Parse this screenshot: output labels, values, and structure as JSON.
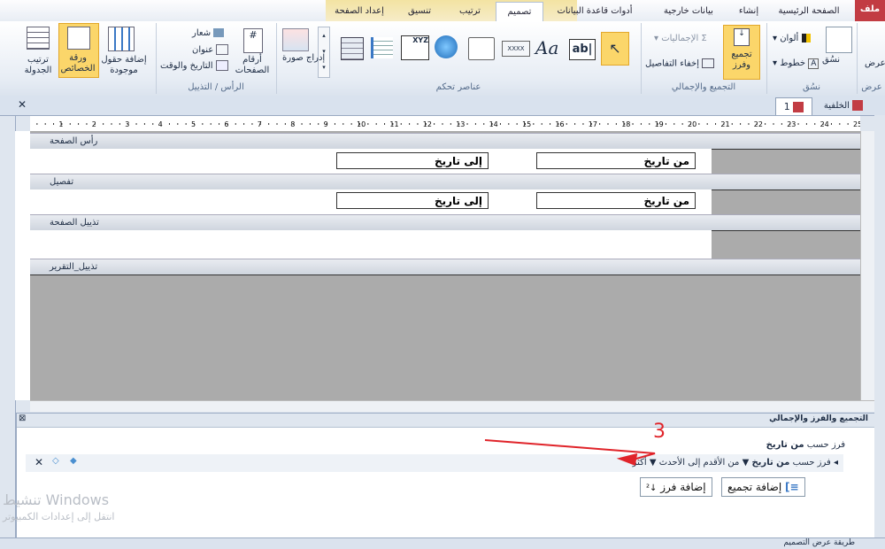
{
  "ribbon_tabs": [
    "الصفحة الرئيسية",
    "إنشاء",
    "بيانات خارجية",
    "أدوات قاعدة البيانات",
    "تصميم",
    "ترتيب",
    "تنسيق",
    "إعداد الصفحة"
  ],
  "file_tab": "ملف",
  "groups": {
    "views": {
      "label": "عرض",
      "btn": "عرض"
    },
    "themes": {
      "label": "نسُق",
      "theme_btn": "نسُق",
      "colors": "ألوان",
      "fonts": "خطوط"
    },
    "grouping": {
      "label": "التجميع والإجمالي",
      "group_sort": "تجميع وفرز",
      "totals": "الإجماليات",
      "hide_details": "إخفاء التفاصيل"
    },
    "controls": {
      "label": "عناصر تحكم",
      "label_btn": "ab|",
      "textbox_btn": "Aa",
      "xxxx": "XXXX",
      "xyz": "XYZ",
      "insert_image": "إدراج صورة"
    },
    "header_footer": {
      "label": "الرأس / التذييل",
      "page_numbers": "أرقام الصفحات",
      "logo": "شعار",
      "title": "عنوان",
      "date_time": "التاريخ والوقت"
    },
    "tools": {
      "add_fields": "إضافة حقول موجودة",
      "property_sheet": "ورقة الخصائص",
      "tab_order": "ترتيب الجدولة"
    }
  },
  "doc_tabs": [
    {
      "label": "1",
      "active": true
    },
    {
      "label": "الخلفية",
      "active": false
    }
  ],
  "ruler_numbers": [
    "1",
    "2",
    "3",
    "4",
    "5",
    "6",
    "7",
    "8",
    "9",
    "10",
    "11",
    "12",
    "13",
    "14",
    "15",
    "16",
    "17",
    "18",
    "19",
    "20",
    "21",
    "22",
    "23",
    "24",
    "25"
  ],
  "sections": {
    "page_header": "رأس الصفحة",
    "detail": "تفصيل",
    "page_footer": "تذييل الصفحة",
    "report_footer": "تذييل_التقرير"
  },
  "controls": {
    "from_date": "من تاريخ",
    "to_date": "إلى تاريخ"
  },
  "group_pane": {
    "title": "التجميع والفرز والإجمالي",
    "row1_prefix": "فرز حسب",
    "row1_field": "من تاريخ",
    "row2_prefix": "فرز حسب",
    "row2_field": "من تاريخ",
    "row2_order": "من الأقدم إلى الأحدث",
    "row2_more": "أكثر",
    "add_group": "إضافة تجميع",
    "add_sort": "إضافة فرز"
  },
  "annotation": "3",
  "watermark": {
    "line1": "تنشيط Windows",
    "line2": "انتقل إلى إعدادات الكمبيوتر"
  },
  "status_text": "طريقة عرض التصميم",
  "colors": {
    "ribbon_tab_sel": "#ffffff",
    "context": "#f3e3a2",
    "file": "#c23c43",
    "arrow": "#e0242a"
  }
}
